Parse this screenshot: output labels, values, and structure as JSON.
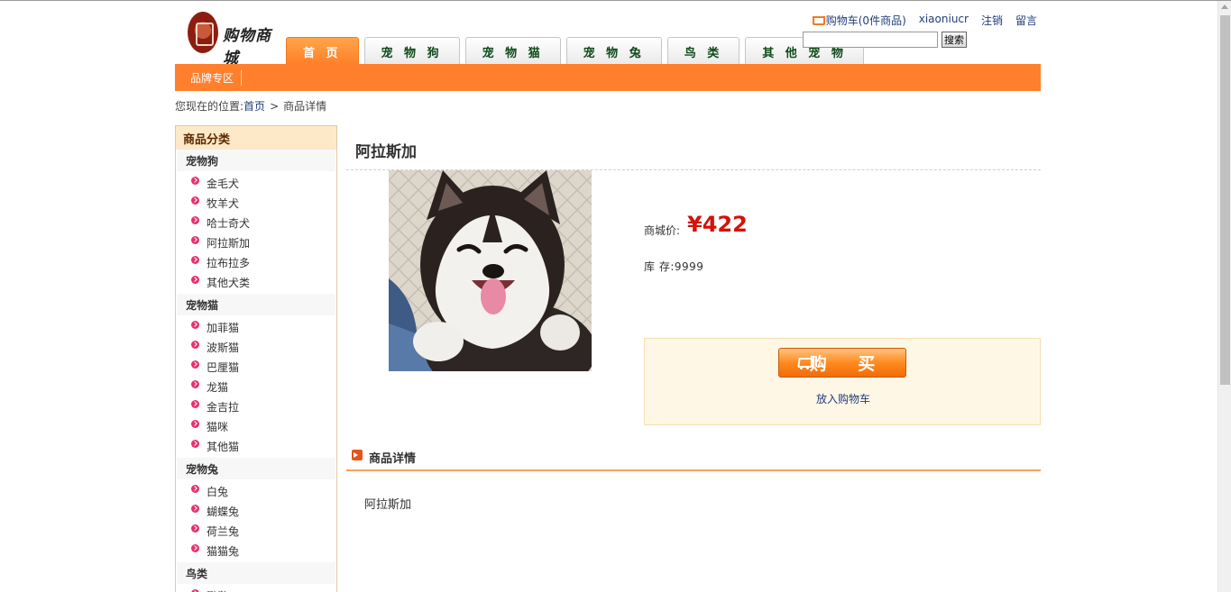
{
  "header": {
    "logo_text": "购物商城",
    "tabs": [
      "首 页",
      "宠 物 狗",
      "宠 物 猫",
      "宠 物 兔",
      "鸟 类",
      "其 他 宠 物"
    ],
    "cart_link": "购物车(0件商品)",
    "username": "xiaoniucr",
    "logout": "注销",
    "message": "留言",
    "search_button": "搜索",
    "search_value": ""
  },
  "navbar": {
    "brand_zone": "品牌专区"
  },
  "breadcrumb": {
    "prefix": "您现在的位置:",
    "home": "首页",
    "sep": ">",
    "current": "商品详情"
  },
  "sidebar": {
    "title": "商品分类",
    "groups": [
      {
        "title": "宠物狗",
        "items": [
          "金毛犬",
          "牧羊犬",
          "哈士奇犬",
          "阿拉斯加",
          "拉布拉多",
          "其他犬类"
        ]
      },
      {
        "title": "宠物猫",
        "items": [
          "加菲猫",
          "波斯猫",
          "巴厘猫",
          "龙猫",
          "金吉拉",
          "猫咪",
          "其他猫"
        ]
      },
      {
        "title": "宠物兔",
        "items": [
          "白兔",
          "蝴蝶兔",
          "荷兰兔",
          "猫猫兔"
        ]
      },
      {
        "title": "鸟类",
        "items": [
          "鹦鹉"
        ]
      }
    ]
  },
  "product": {
    "name": "阿拉斯加",
    "price_label": "商城价:",
    "price": "¥422",
    "stock_label": "库 存:",
    "stock": "9999",
    "buy_button": "购 买",
    "add_to_cart": "放入购物车",
    "detail_title": "商品详情",
    "detail_text": "阿拉斯加"
  },
  "colors": {
    "accent": "#ff7f2d",
    "price": "#d3120a",
    "link": "#223d7a"
  }
}
